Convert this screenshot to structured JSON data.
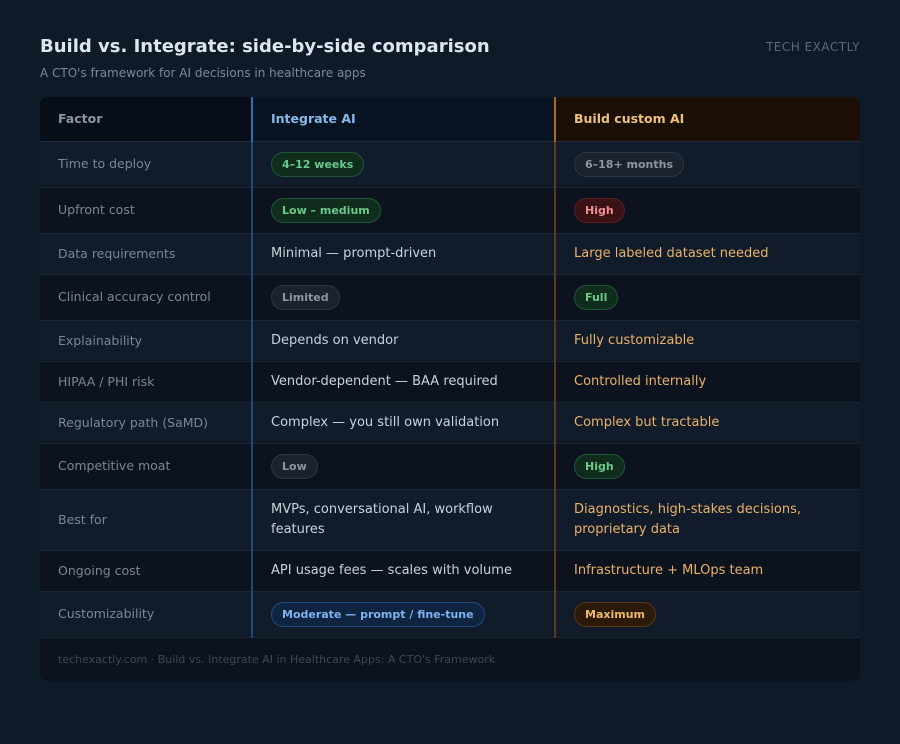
{
  "header": {
    "title": "Build vs. Integrate: side-by-side comparison",
    "subtitle": "A CTO's framework for AI decisions in healthcare apps",
    "brand": "TECH EXACTLY"
  },
  "table": {
    "columns": [
      "Factor",
      "Integrate AI",
      "Build custom AI"
    ],
    "rows": [
      {
        "factor": "Time to deploy",
        "integrate": {
          "text": "4–12 weeks",
          "pill": "green"
        },
        "build": {
          "text": "6–18+ months",
          "pill": "gray"
        }
      },
      {
        "factor": "Upfront cost",
        "integrate": {
          "text": "Low – medium",
          "pill": "green"
        },
        "build": {
          "text": "High",
          "pill": "red"
        }
      },
      {
        "factor": "Data requirements",
        "integrate": {
          "text": "Minimal — prompt-driven"
        },
        "build": {
          "text": "Large labeled dataset needed"
        }
      },
      {
        "factor": "Clinical accuracy control",
        "integrate": {
          "text": "Limited",
          "pill": "gray"
        },
        "build": {
          "text": "Full",
          "pill": "green"
        }
      },
      {
        "factor": "Explainability",
        "integrate": {
          "text": "Depends on vendor"
        },
        "build": {
          "text": "Fully customizable"
        }
      },
      {
        "factor": "HIPAA / PHI risk",
        "integrate": {
          "text": "Vendor-dependent — BAA required"
        },
        "build": {
          "text": "Controlled internally"
        }
      },
      {
        "factor": "Regulatory path (SaMD)",
        "integrate": {
          "text": "Complex — you still own validation"
        },
        "build": {
          "text": "Complex but tractable"
        }
      },
      {
        "factor": "Competitive moat",
        "integrate": {
          "text": "Low",
          "pill": "gray"
        },
        "build": {
          "text": "High",
          "pill": "green"
        }
      },
      {
        "factor": "Best for",
        "integrate": {
          "text": "MVPs, conversational AI, workflow features"
        },
        "build": {
          "text": "Diagnostics, high-stakes decisions, proprietary data"
        }
      },
      {
        "factor": "Ongoing cost",
        "integrate": {
          "text": "API usage fees — scales with volume"
        },
        "build": {
          "text": "Infrastructure + MLOps team"
        }
      },
      {
        "factor": "Customizability",
        "integrate": {
          "text": "Moderate — prompt / fine-tune",
          "pill": "blue"
        },
        "build": {
          "text": "Maximum",
          "pill": "amber"
        }
      }
    ]
  },
  "footer": {
    "text": "techexactly.com · Build vs. Integrate AI in Healthcare Apps: A CTO's Framework"
  },
  "colors": {
    "background": "#0f1a28",
    "integrate_accent": "#2c6fb8",
    "build_accent": "#a86a20"
  }
}
